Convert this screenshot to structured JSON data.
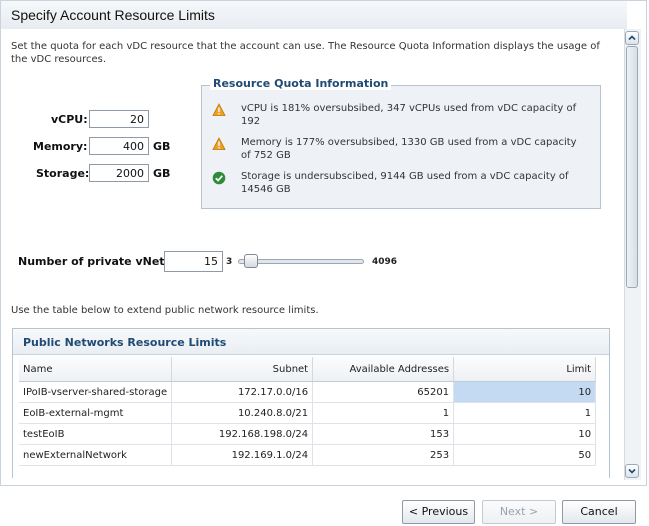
{
  "dialog": {
    "title": "Specify Account Resource Limits",
    "intro": "Set the quota for each vDC resource that the account can use. The Resource Quota Information displays the usage of the vDC resources."
  },
  "resources": {
    "vcpu": {
      "label": "vCPU:",
      "value": "20",
      "unit": ""
    },
    "memory": {
      "label": "Memory:",
      "value": "400",
      "unit": "GB"
    },
    "storage": {
      "label": "Storage:",
      "value": "2000",
      "unit": "GB"
    }
  },
  "quota_info": {
    "title": "Resource Quota Information",
    "items": [
      {
        "icon": "warning-icon",
        "text": "vCPU is 181% oversubsibed, 347 vCPUs used from vDC capacity of 192"
      },
      {
        "icon": "warning-icon",
        "text": "Memory is 177% oversubsibed, 1330 GB used from a vDC capacity of 752 GB"
      },
      {
        "icon": "check-icon",
        "text": "Storage is undersubscibed, 9144 GB used from a vDC capacity of 14546 GB"
      }
    ]
  },
  "vnets": {
    "label": "Number of private vNets:",
    "value": "15",
    "slider_min": "3",
    "slider_max": "4096"
  },
  "table_intro": "Use the table below to extend public network resource limits.",
  "public_networks": {
    "title": "Public Networks Resource Limits",
    "columns": [
      "Name",
      "Subnet",
      "Available Addresses",
      "Limit"
    ],
    "rows": [
      {
        "name": "IPoIB-vserver-shared-storage",
        "subnet": "172.17.0.0/16",
        "available": "65201",
        "limit": "10"
      },
      {
        "name": "EoIB-external-mgmt",
        "subnet": "10.240.8.0/21",
        "available": "1",
        "limit": "1"
      },
      {
        "name": "testEoIB",
        "subnet": "192.168.198.0/24",
        "available": "153",
        "limit": "10"
      },
      {
        "name": "newExternalNetwork",
        "subnet": "192.169.1.0/24",
        "available": "253",
        "limit": "50"
      }
    ]
  },
  "footer": {
    "previous": "< Previous",
    "next": "Next >",
    "cancel": "Cancel"
  },
  "colors": {
    "accent": "#1f4a74",
    "warning": "#f0a020",
    "success": "#2e8b3a",
    "selection": "#c4daf2"
  }
}
